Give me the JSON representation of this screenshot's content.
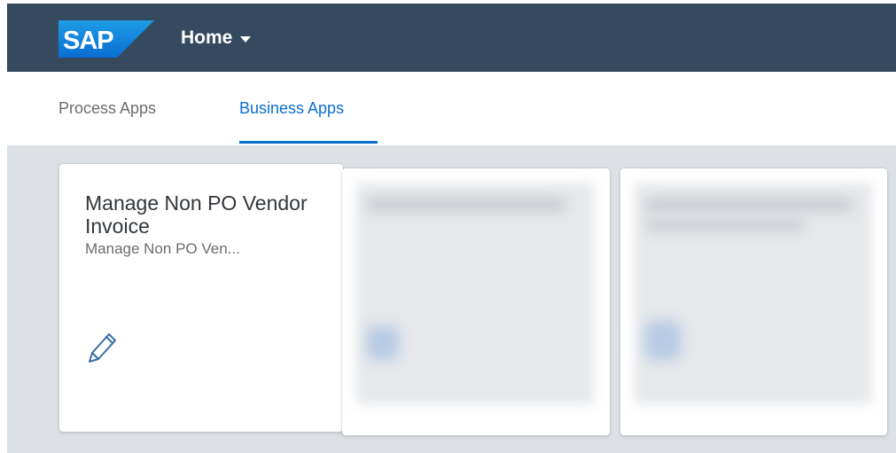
{
  "shell": {
    "logo_text": "SAP",
    "home_label": "Home",
    "colors": {
      "shell_background": "#354a5f",
      "logo_blue": "#0a6ed1",
      "accent": "#0a6ed1"
    }
  },
  "tabs": [
    {
      "label": "Process Apps",
      "selected": false
    },
    {
      "label": "Business Apps",
      "selected": true
    }
  ],
  "tiles": [
    {
      "title": "Manage Non PO Vendor Invoice",
      "subtitle": "Manage Non PO Ven...",
      "icon": "pencil-icon"
    }
  ]
}
